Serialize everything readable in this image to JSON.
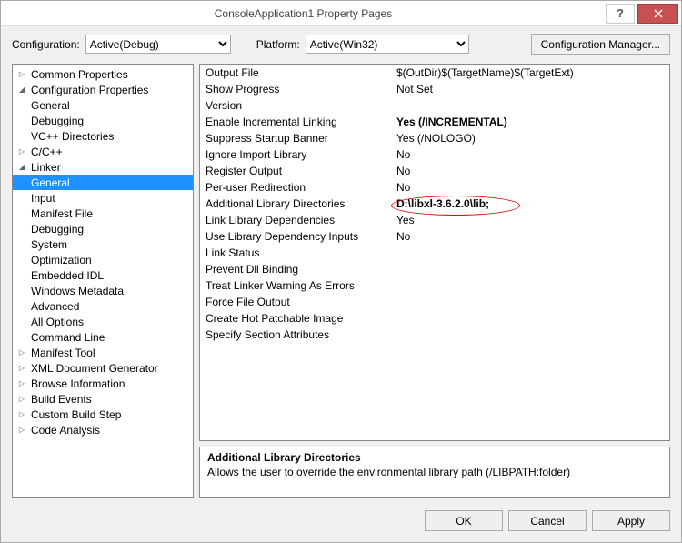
{
  "window": {
    "title": "ConsoleApplication1 Property Pages"
  },
  "configRow": {
    "configLabel": "Configuration:",
    "configValue": "Active(Debug)",
    "platformLabel": "Platform:",
    "platformValue": "Active(Win32)",
    "configMgr": "Configuration Manager..."
  },
  "tree": [
    {
      "depth": 1,
      "arrow": "closed",
      "label": "Common Properties"
    },
    {
      "depth": 1,
      "arrow": "open",
      "label": "Configuration Properties"
    },
    {
      "depth": 2,
      "arrow": "",
      "label": "General"
    },
    {
      "depth": 2,
      "arrow": "",
      "label": "Debugging"
    },
    {
      "depth": 2,
      "arrow": "",
      "label": "VC++ Directories"
    },
    {
      "depth": 2,
      "arrow": "closed",
      "label": "C/C++"
    },
    {
      "depth": 2,
      "arrow": "open",
      "label": "Linker"
    },
    {
      "depth": 3,
      "arrow": "",
      "label": "General",
      "selected": true
    },
    {
      "depth": 3,
      "arrow": "",
      "label": "Input"
    },
    {
      "depth": 3,
      "arrow": "",
      "label": "Manifest File"
    },
    {
      "depth": 3,
      "arrow": "",
      "label": "Debugging"
    },
    {
      "depth": 3,
      "arrow": "",
      "label": "System"
    },
    {
      "depth": 3,
      "arrow": "",
      "label": "Optimization"
    },
    {
      "depth": 3,
      "arrow": "",
      "label": "Embedded IDL"
    },
    {
      "depth": 3,
      "arrow": "",
      "label": "Windows Metadata"
    },
    {
      "depth": 3,
      "arrow": "",
      "label": "Advanced"
    },
    {
      "depth": 3,
      "arrow": "",
      "label": "All Options"
    },
    {
      "depth": 3,
      "arrow": "",
      "label": "Command Line"
    },
    {
      "depth": 2,
      "arrow": "closed",
      "label": "Manifest Tool"
    },
    {
      "depth": 2,
      "arrow": "closed",
      "label": "XML Document Generator"
    },
    {
      "depth": 2,
      "arrow": "closed",
      "label": "Browse Information"
    },
    {
      "depth": 2,
      "arrow": "closed",
      "label": "Build Events"
    },
    {
      "depth": 2,
      "arrow": "closed",
      "label": "Custom Build Step"
    },
    {
      "depth": 2,
      "arrow": "closed",
      "label": "Code Analysis"
    }
  ],
  "props": [
    {
      "key": "Output File",
      "val": "$(OutDir)$(TargetName)$(TargetExt)"
    },
    {
      "key": "Show Progress",
      "val": "Not Set"
    },
    {
      "key": "Version",
      "val": ""
    },
    {
      "key": "Enable Incremental Linking",
      "val": "Yes (/INCREMENTAL)",
      "bold": true
    },
    {
      "key": "Suppress Startup Banner",
      "val": "Yes (/NOLOGO)"
    },
    {
      "key": "Ignore Import Library",
      "val": "No"
    },
    {
      "key": "Register Output",
      "val": "No"
    },
    {
      "key": "Per-user Redirection",
      "val": "No"
    },
    {
      "key": "Additional Library Directories",
      "val": "D:\\libxl-3.6.2.0\\lib;",
      "bold": true,
      "circle": true
    },
    {
      "key": "Link Library Dependencies",
      "val": "Yes"
    },
    {
      "key": "Use Library Dependency Inputs",
      "val": "No"
    },
    {
      "key": "Link Status",
      "val": ""
    },
    {
      "key": "Prevent Dll Binding",
      "val": ""
    },
    {
      "key": "Treat Linker Warning As Errors",
      "val": ""
    },
    {
      "key": "Force File Output",
      "val": ""
    },
    {
      "key": "Create Hot Patchable Image",
      "val": ""
    },
    {
      "key": "Specify Section Attributes",
      "val": ""
    }
  ],
  "desc": {
    "title": "Additional Library Directories",
    "text": "Allows the user to override the environmental library path (/LIBPATH:folder)"
  },
  "footer": {
    "ok": "OK",
    "cancel": "Cancel",
    "apply": "Apply"
  }
}
